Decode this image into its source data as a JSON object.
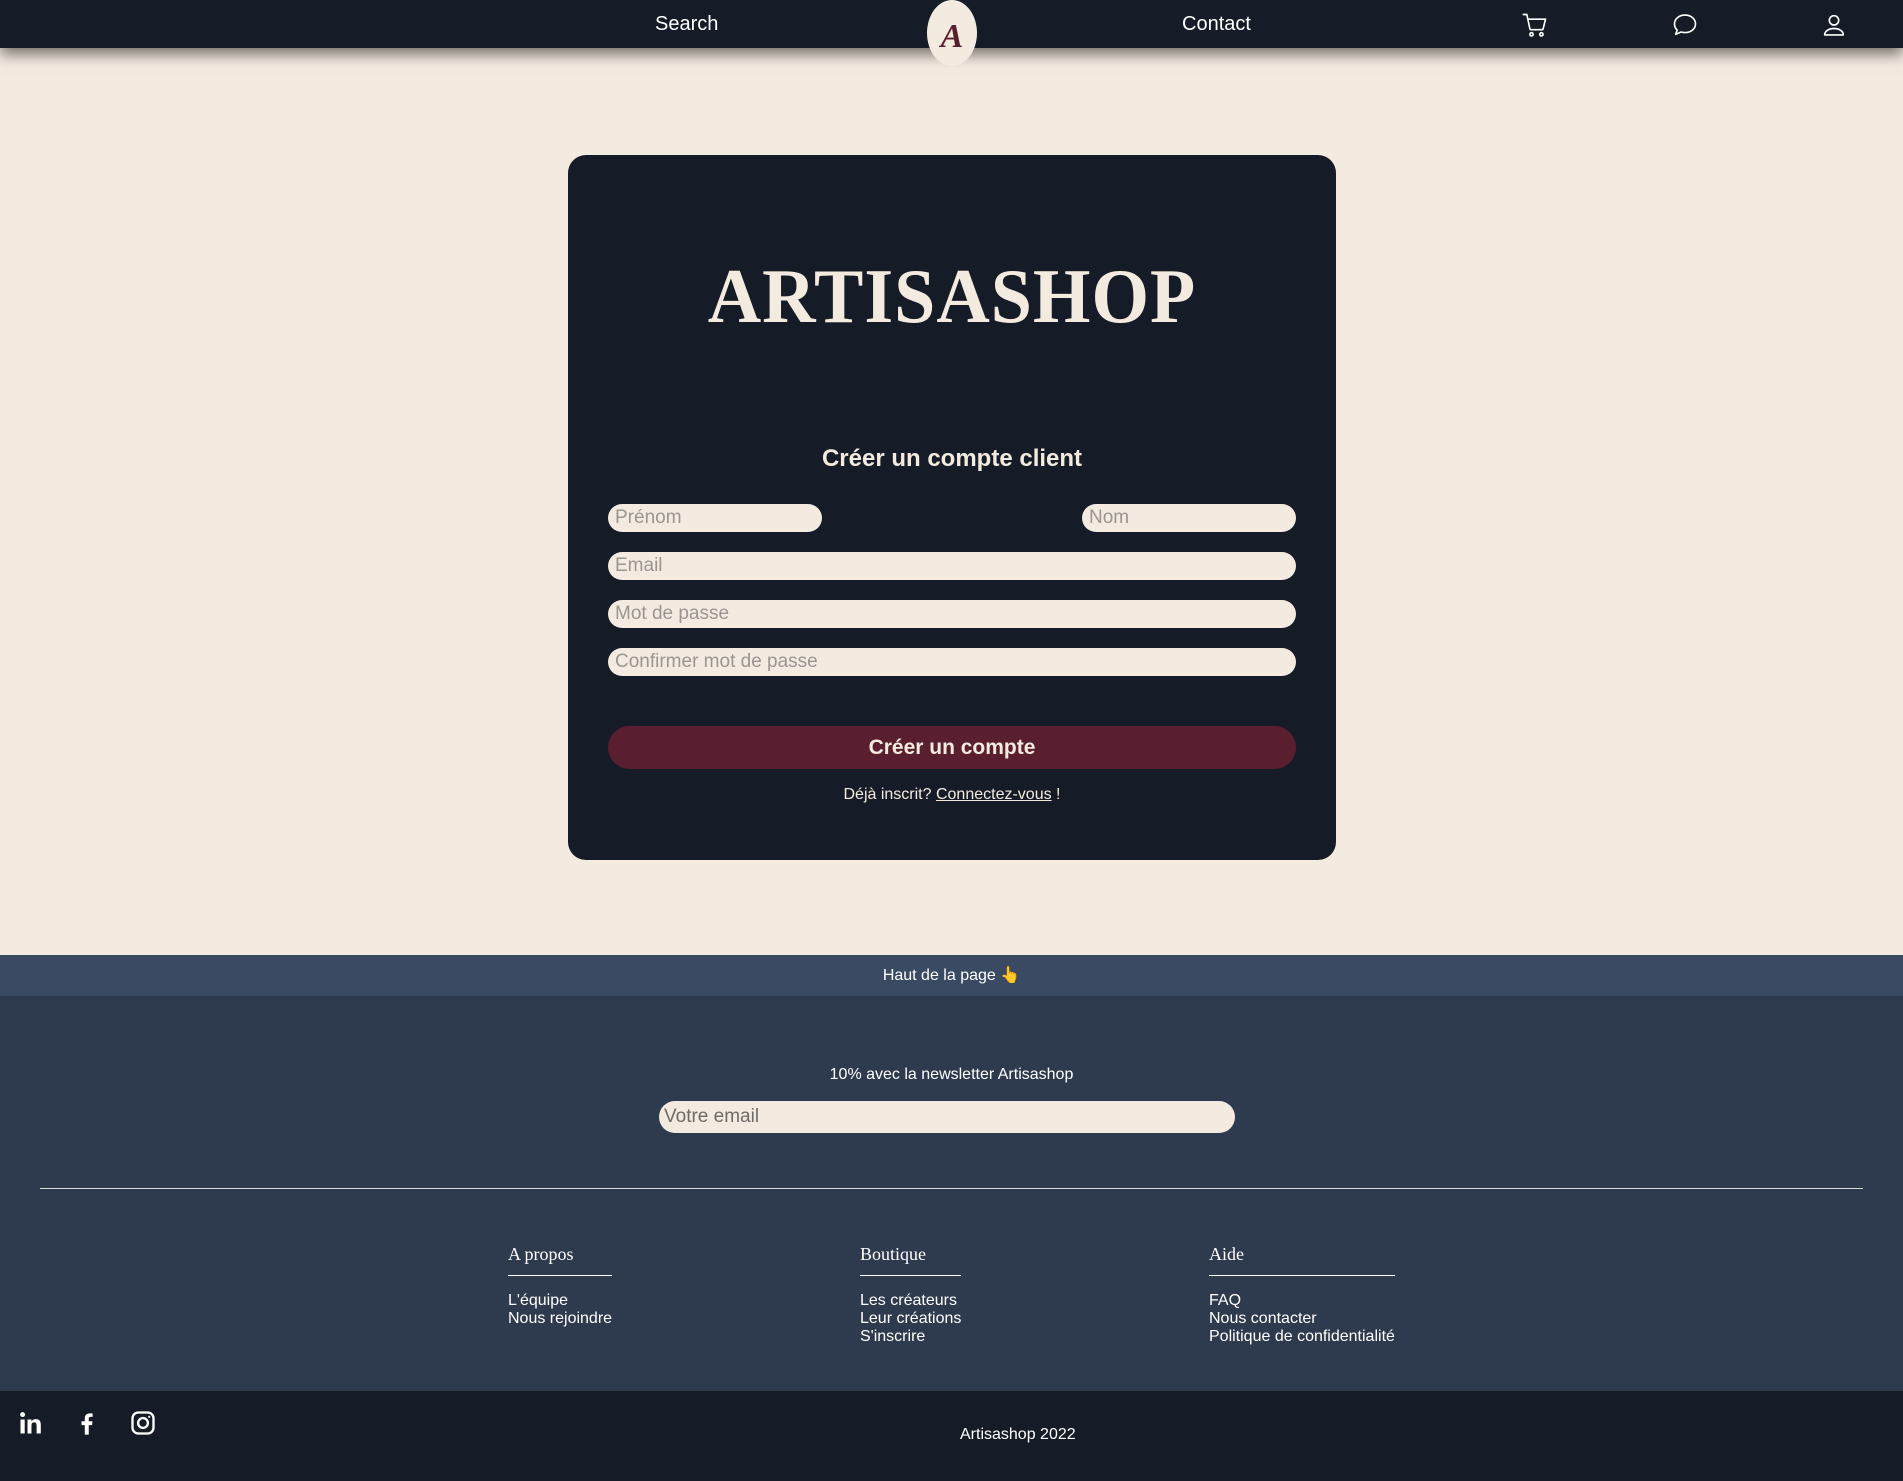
{
  "nav": {
    "search_label": "Search",
    "contact_label": "Contact",
    "logo_mark": "A",
    "icons": [
      "cart-icon",
      "chat-icon",
      "user-icon"
    ]
  },
  "card": {
    "brand_logo": "ARTISASHOP",
    "title": "Créer un compte client",
    "fields": {
      "first_name_placeholder": "Prénom",
      "last_name_placeholder": "Nom",
      "email_placeholder": "Email",
      "password_placeholder": "Mot de passe",
      "confirm_placeholder": "Confirmer mot de passe"
    },
    "submit_label": "Créer un compte",
    "login_prefix": "Déjà inscrit?",
    "login_link": "Connectez-vous",
    "login_suffix": "!"
  },
  "back_to_top": {
    "label": "Haut de la page",
    "emoji": "👆"
  },
  "footer": {
    "newsletter_text": "10% avec la newsletter Artisashop",
    "newsletter_placeholder": "Votre email",
    "columns": [
      {
        "title": "A propos",
        "links": [
          "L'équipe",
          "Nous rejoindre"
        ]
      },
      {
        "title": "Boutique",
        "links": [
          "Les créateurs",
          "Leur créations",
          "S'inscrire"
        ]
      },
      {
        "title": "Aide",
        "links": [
          "FAQ",
          "Nous contacter",
          "Politique de confidentialité"
        ]
      }
    ],
    "social_icons": [
      "linkedin-icon",
      "facebook-icon",
      "instagram-icon"
    ],
    "copyright": "Artisashop 2022"
  },
  "colors": {
    "page_bg": "#f4ebe0",
    "dark": "#161c27",
    "accent": "#5a1f2e",
    "back_to_top_bg": "#3a4a63",
    "footer_bg": "#2e3a4d"
  }
}
